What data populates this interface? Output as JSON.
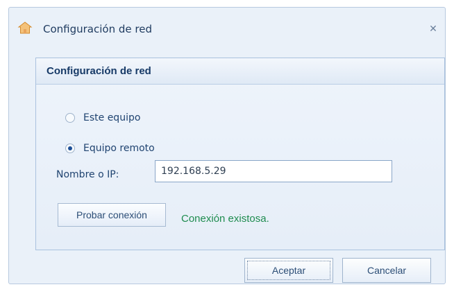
{
  "window": {
    "title": "Configuración de red",
    "close_glyph": "✕",
    "icon": "house-icon"
  },
  "group": {
    "title": "Configuración de red",
    "options": [
      {
        "label": "Este equipo",
        "checked": false
      },
      {
        "label": "Equipo remoto",
        "checked": true
      }
    ],
    "ip_label": "Nombre o IP:",
    "ip_value": "192.168.5.29",
    "test_button": "Probar conexión",
    "status_text": "Conexión existosa."
  },
  "buttons": {
    "accept": "Aceptar",
    "cancel": "Cancelar"
  },
  "colors": {
    "status_success": "#1f8c4f",
    "accent": "#1d4f97"
  }
}
